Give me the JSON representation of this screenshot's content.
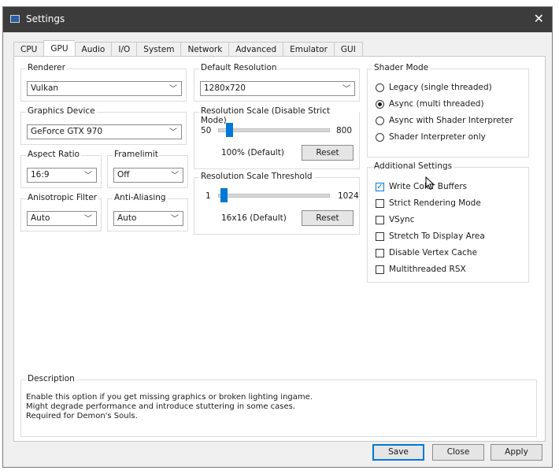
{
  "window": {
    "title": "Settings"
  },
  "tabs": [
    "CPU",
    "GPU",
    "Audio",
    "I/O",
    "System",
    "Network",
    "Advanced",
    "Emulator",
    "GUI"
  ],
  "active_tab": "GPU",
  "renderer": {
    "label": "Renderer",
    "value": "Vulkan"
  },
  "graphics_device": {
    "label": "Graphics Device",
    "value": "GeForce GTX 970"
  },
  "aspect_ratio": {
    "label": "Aspect Ratio",
    "value": "16:9"
  },
  "framelimit": {
    "label": "Framelimit",
    "value": "Off"
  },
  "anisotropic_filter": {
    "label": "Anisotropic Filter",
    "value": "Auto"
  },
  "anti_aliasing": {
    "label": "Anti-Aliasing",
    "value": "Auto"
  },
  "default_resolution": {
    "label": "Default Resolution",
    "value": "1280x720"
  },
  "resolution_scale": {
    "label": "Resolution Scale (Disable Strict Mode)",
    "min": "50",
    "max": "800",
    "value_text": "100% (Default)",
    "value": 100,
    "reset_label": "Reset"
  },
  "resolution_scale_threshold": {
    "label": "Resolution Scale Threshold",
    "min": "1",
    "max": "1024",
    "value_text": "16x16 (Default)",
    "value": 16,
    "reset_label": "Reset"
  },
  "shader_mode": {
    "label": "Shader Mode",
    "options": [
      {
        "label": "Legacy (single threaded)",
        "selected": false
      },
      {
        "label": "Async (multi threaded)",
        "selected": true
      },
      {
        "label": "Async with Shader Interpreter",
        "selected": false
      },
      {
        "label": "Shader Interpreter only",
        "selected": false
      }
    ]
  },
  "additional_settings": {
    "label": "Additional Settings",
    "options": [
      {
        "label": "Write Color Buffers",
        "checked": true
      },
      {
        "label": "Strict Rendering Mode",
        "checked": false
      },
      {
        "label": "VSync",
        "checked": false
      },
      {
        "label": "Stretch To Display Area",
        "checked": false
      },
      {
        "label": "Disable Vertex Cache",
        "checked": false
      },
      {
        "label": "Multithreaded RSX",
        "checked": false
      }
    ]
  },
  "description": {
    "label": "Description",
    "lines": [
      "Enable this option if you get missing graphics or broken lighting ingame.",
      "Might degrade performance and introduce stuttering in some cases.",
      "Required for Demon's Souls."
    ]
  },
  "footer": {
    "save": "Save",
    "close": "Close",
    "apply": "Apply"
  },
  "colors": {
    "accent": "#0078d7",
    "titlebar": "#3c3c3c"
  }
}
